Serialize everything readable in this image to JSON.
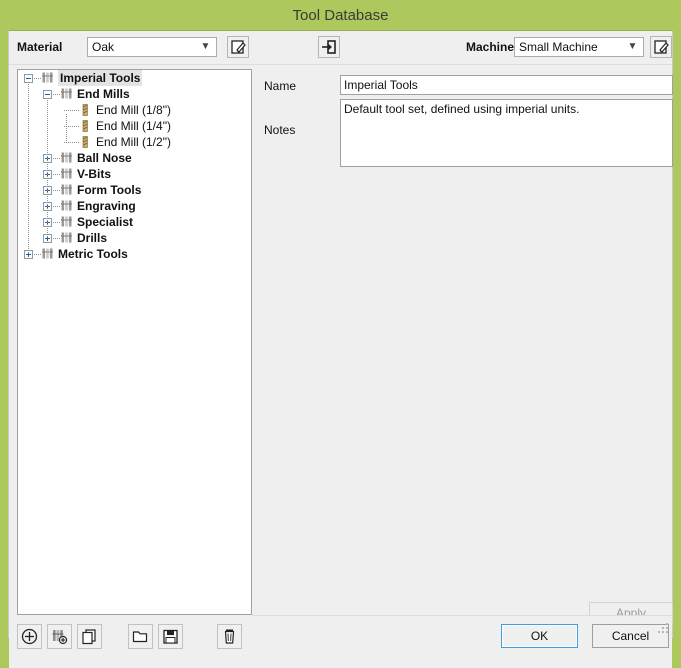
{
  "window": {
    "title": "Tool Database",
    "accent_color": "#adc95e",
    "client_bg": "#efefef"
  },
  "toolbar": {
    "material_label": "Material",
    "material_value": "Oak",
    "material_options": [
      "Oak"
    ],
    "edit_material_icon": "edit-pencil-icon",
    "import_icon": "import-arrow-icon",
    "machine_label": "Machine",
    "machine_value": "Small Machine",
    "machine_options": [
      "Small Machine"
    ],
    "edit_machine_icon": "edit-pencil-icon"
  },
  "tree": {
    "selected": "Imperial Tools",
    "nodes": [
      {
        "label": "Imperial Tools",
        "depth": 0,
        "type": "folder",
        "expander": "minus",
        "selected": true
      },
      {
        "label": "End Mills",
        "depth": 1,
        "type": "folder",
        "expander": "minus",
        "selected": false
      },
      {
        "label": "End Mill (1/8\")",
        "depth": 2,
        "type": "leaf",
        "expander": "none",
        "selected": false
      },
      {
        "label": "End Mill (1/4\")",
        "depth": 2,
        "type": "leaf",
        "expander": "none",
        "selected": false
      },
      {
        "label": "End Mill (1/2\")",
        "depth": 2,
        "type": "leaf",
        "expander": "none",
        "selected": false
      },
      {
        "label": "Ball Nose",
        "depth": 1,
        "type": "folder",
        "expander": "plus",
        "selected": false
      },
      {
        "label": "V-Bits",
        "depth": 1,
        "type": "folder",
        "expander": "plus",
        "selected": false
      },
      {
        "label": "Form Tools",
        "depth": 1,
        "type": "folder",
        "expander": "plus",
        "selected": false
      },
      {
        "label": "Engraving",
        "depth": 1,
        "type": "folder",
        "expander": "plus",
        "selected": false
      },
      {
        "label": "Specialist",
        "depth": 1,
        "type": "folder",
        "expander": "plus",
        "selected": false
      },
      {
        "label": "Drills",
        "depth": 1,
        "type": "folder",
        "expander": "plus",
        "selected": false
      },
      {
        "label": "Metric Tools",
        "depth": 0,
        "type": "folder",
        "expander": "plus",
        "selected": false
      }
    ]
  },
  "detail": {
    "name_label": "Name",
    "name_value": "Imperial Tools",
    "notes_label": "Notes",
    "notes_value": "Default tool set, defined using imperial units.",
    "apply_label": "Apply",
    "apply_enabled": false
  },
  "bottom_toolbar": {
    "buttons": [
      {
        "name": "add-tool-group-button",
        "icon": "plus-circle-icon"
      },
      {
        "name": "add-tool-button",
        "icon": "tool-add-icon"
      },
      {
        "name": "copy-button",
        "icon": "copy-icon"
      },
      {
        "name": "open-button",
        "icon": "folder-open-icon"
      },
      {
        "name": "save-button",
        "icon": "floppy-save-icon"
      },
      {
        "name": "delete-button",
        "icon": "trash-icon"
      }
    ]
  },
  "dialog_buttons": {
    "ok_label": "OK",
    "cancel_label": "Cancel"
  }
}
